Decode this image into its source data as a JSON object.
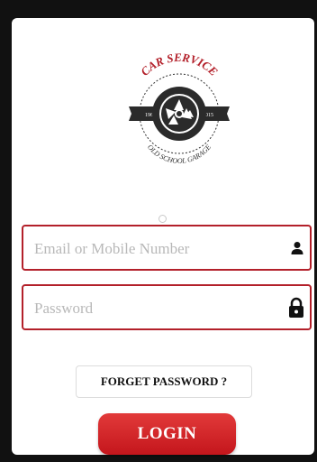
{
  "logo": {
    "top_text": "CAR SERVICE",
    "bottom_text": "OLD SCHOOL GARAGE",
    "year_left": "1960",
    "year_right": "2015"
  },
  "form": {
    "email_placeholder": "Email or Mobile Number",
    "email_value": "",
    "password_placeholder": "Password",
    "password_value": "",
    "email_icon": "user-icon",
    "password_icon": "lock-icon"
  },
  "buttons": {
    "forget_label": "FORGET PASSWORD ?",
    "login_label": "LOGIN"
  },
  "colors": {
    "accent": "#c4161c",
    "field_border": "#b3202a"
  }
}
